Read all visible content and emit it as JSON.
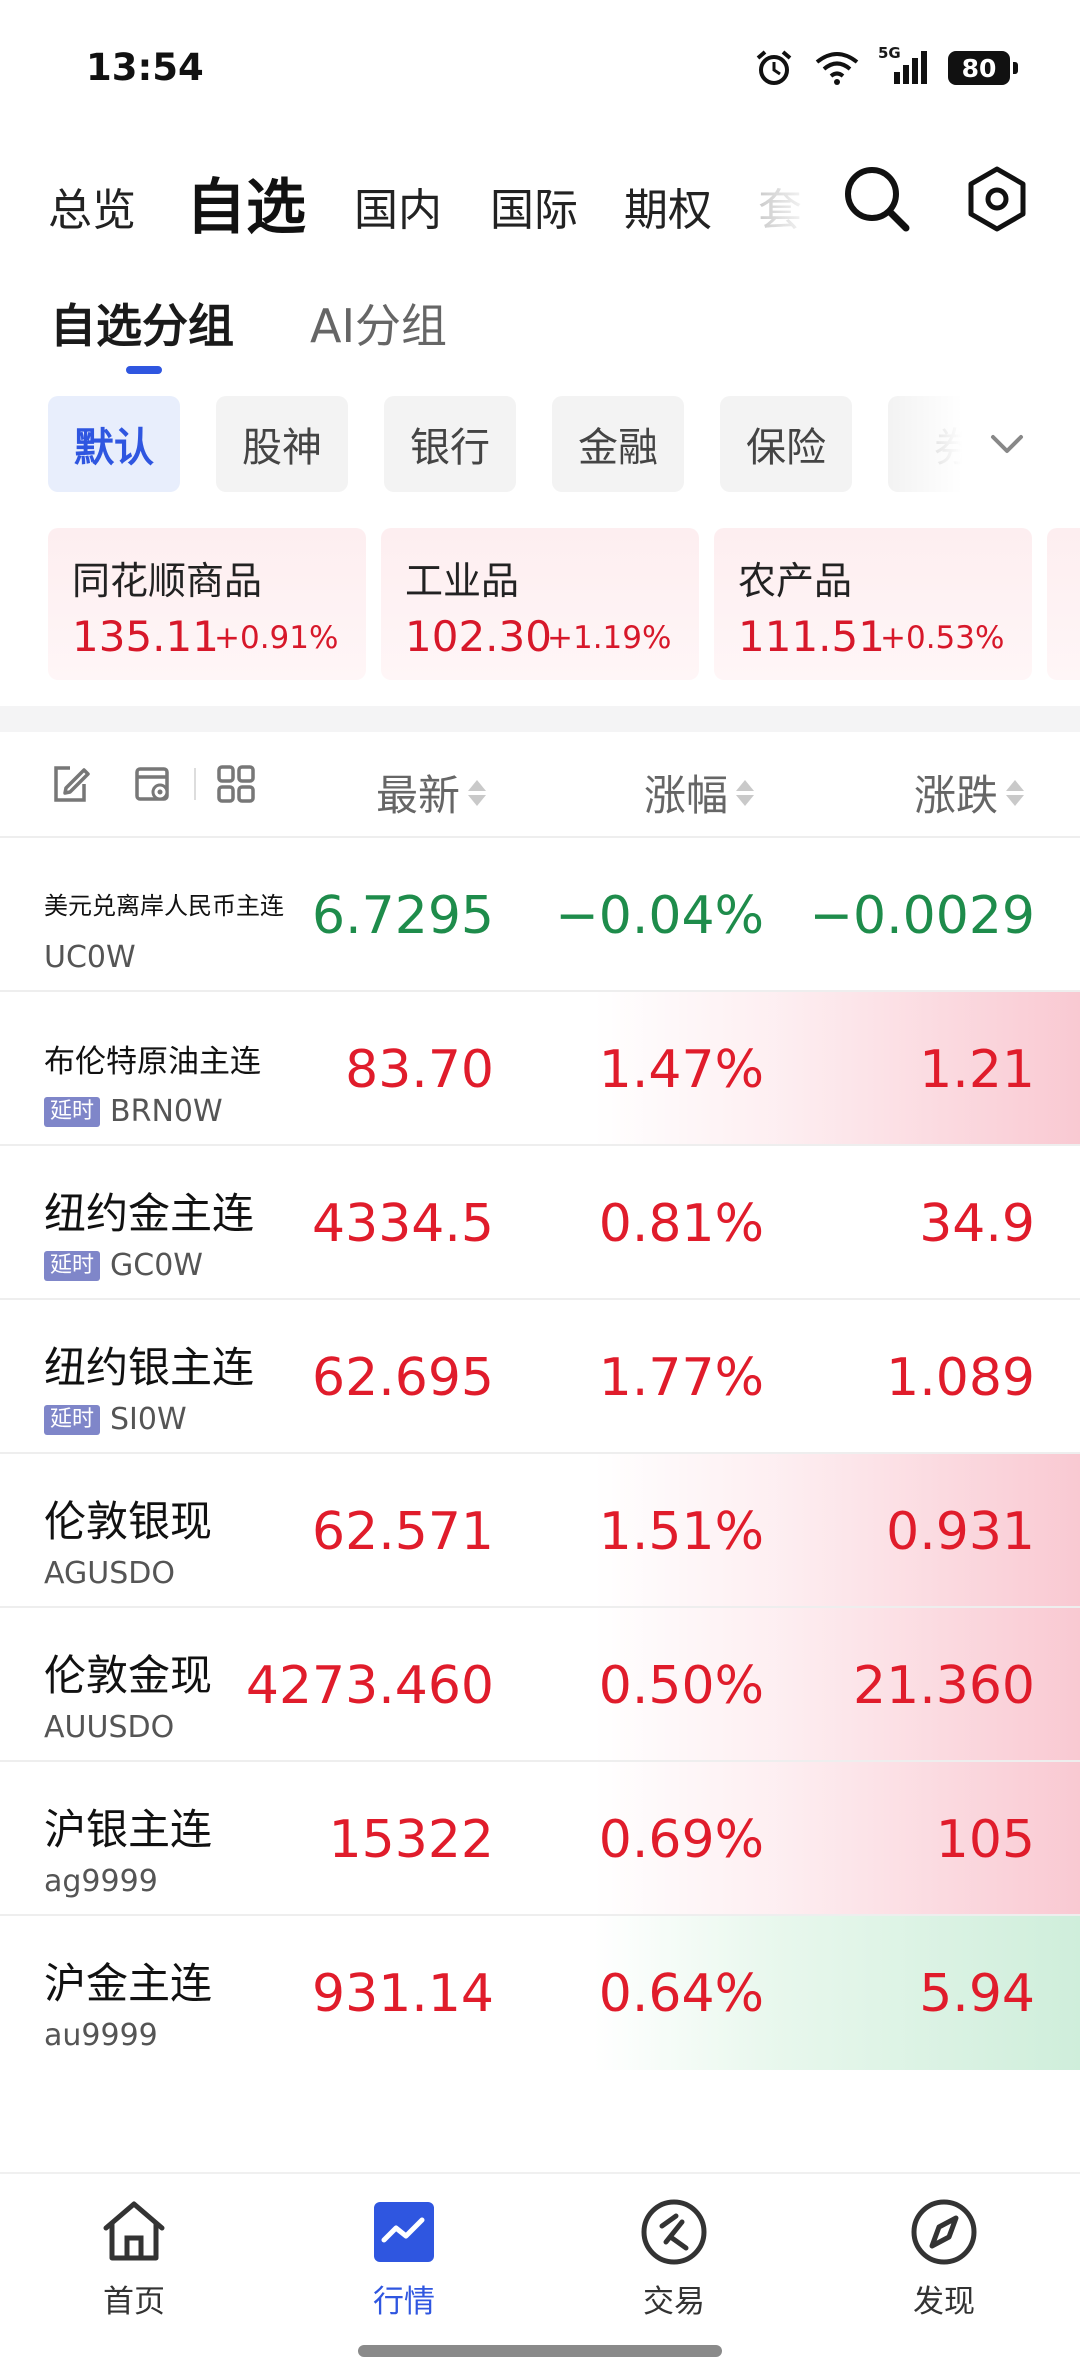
{
  "status_bar": {
    "time": "13:54",
    "network": "5G",
    "battery": "80"
  },
  "top_nav": {
    "tabs": [
      {
        "label": "总览"
      },
      {
        "label": "自选"
      },
      {
        "label": "国内"
      },
      {
        "label": "国际"
      },
      {
        "label": "期权"
      },
      {
        "label": "套"
      }
    ],
    "active": "自选"
  },
  "group_tabs": {
    "selected": "自选分组",
    "other": "AI分组"
  },
  "chips": {
    "items": [
      {
        "label": "默认"
      },
      {
        "label": "股神"
      },
      {
        "label": "银行"
      },
      {
        "label": "金融"
      },
      {
        "label": "保险"
      },
      {
        "label": "券"
      }
    ],
    "active": "默认"
  },
  "index_cards": [
    {
      "name": "同花顺商品",
      "value": "135.11",
      "change": "+0.91%"
    },
    {
      "name": "工业品",
      "value": "102.30",
      "change": "+1.19%"
    },
    {
      "name": "农产品",
      "value": "111.51",
      "change": "+0.53%"
    }
  ],
  "table": {
    "headers": {
      "latest": "最新",
      "pct": "涨幅",
      "change": "涨跌"
    },
    "rows": [
      {
        "name": "美元兑离岸人民币主连",
        "code": "UC0W",
        "tag": "",
        "latest": "6.7295",
        "pct": "−0.04%",
        "change": "−0.0029",
        "trend": "down"
      },
      {
        "name": "布伦特原油主连",
        "code": "BRN0W",
        "tag": "延时",
        "latest": "83.70",
        "pct": "1.47%",
        "change": "1.21",
        "trend": "up"
      },
      {
        "name": "纽约金主连",
        "code": "GC0W",
        "tag": "延时",
        "latest": "4334.5",
        "pct": "0.81%",
        "change": "34.9",
        "trend": "up"
      },
      {
        "name": "纽约银主连",
        "code": "SI0W",
        "tag": "延时",
        "latest": "62.695",
        "pct": "1.77%",
        "change": "1.089",
        "trend": "up"
      },
      {
        "name": "伦敦银现",
        "code": "AGUSDO",
        "tag": "",
        "latest": "62.571",
        "pct": "1.51%",
        "change": "0.931",
        "trend": "up"
      },
      {
        "name": "伦敦金现",
        "code": "AUUSDO",
        "tag": "",
        "latest": "4273.460",
        "pct": "0.50%",
        "change": "21.360",
        "trend": "up"
      },
      {
        "name": "沪银主连",
        "code": "ag9999",
        "tag": "",
        "latest": "15322",
        "pct": "0.69%",
        "change": "105",
        "trend": "up"
      },
      {
        "name": "沪金主连",
        "code": "au9999",
        "tag": "",
        "latest": "931.14",
        "pct": "0.64%",
        "change": "5.94",
        "trend": "up"
      }
    ]
  },
  "bottom_nav": {
    "items": [
      {
        "label": "首页"
      },
      {
        "label": "行情"
      },
      {
        "label": "交易"
      },
      {
        "label": "发现"
      }
    ],
    "active": "行情"
  },
  "colors": {
    "accent": "#2f56e0",
    "up": "#e01c2b",
    "down": "#1e8c4b"
  }
}
